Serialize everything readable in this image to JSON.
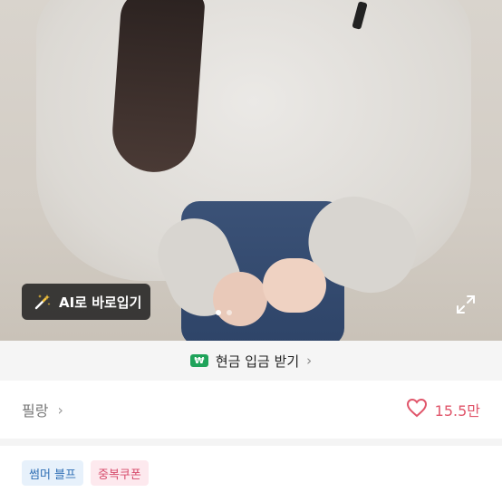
{
  "hero": {
    "ai_button_label": "AI로 바로입기",
    "image_count": 2,
    "active_index": 0
  },
  "cash_bar": {
    "badge": "₩",
    "text": "현금 입금 받기",
    "chevron": "›"
  },
  "shop": {
    "name": "필랑",
    "chevron": "›"
  },
  "like": {
    "count": "15.5만"
  },
  "tags": [
    {
      "label": "썸머 블프",
      "color": "#2f6fb5"
    },
    {
      "label": "중복쿠폰",
      "color": "#d64a6a"
    }
  ],
  "icons": {
    "ai": "magic-wand-icon",
    "expand": "expand-icon",
    "heart": "heart-outline-icon"
  }
}
